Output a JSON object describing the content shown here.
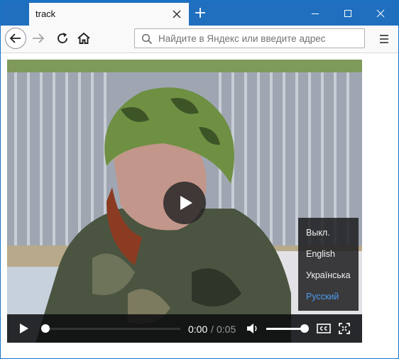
{
  "tab": {
    "title": "track"
  },
  "urlbar": {
    "placeholder": "Найдите в Яндекс или введите адрес"
  },
  "player": {
    "current_time": "0:00",
    "separator": "/",
    "duration": "0:05",
    "progress": 0,
    "volume": 1.0,
    "captions_menu": {
      "items": [
        "Выкл.",
        "English",
        "Українська",
        "Русский"
      ],
      "selected": "Русский"
    }
  },
  "colors": {
    "titlebar": "#1f6fbe",
    "selected_caption": "#4d9df0"
  },
  "icons": {
    "tab_close": "close-icon",
    "new_tab": "plus-icon",
    "back": "arrow-left-icon",
    "forward": "arrow-right-icon",
    "reload": "reload-icon",
    "home": "home-icon",
    "search": "search-icon",
    "menu": "hamburger-icon",
    "play": "play-icon",
    "volume": "volume-icon",
    "captions": "cc-icon",
    "fullscreen": "fullscreen-icon"
  }
}
